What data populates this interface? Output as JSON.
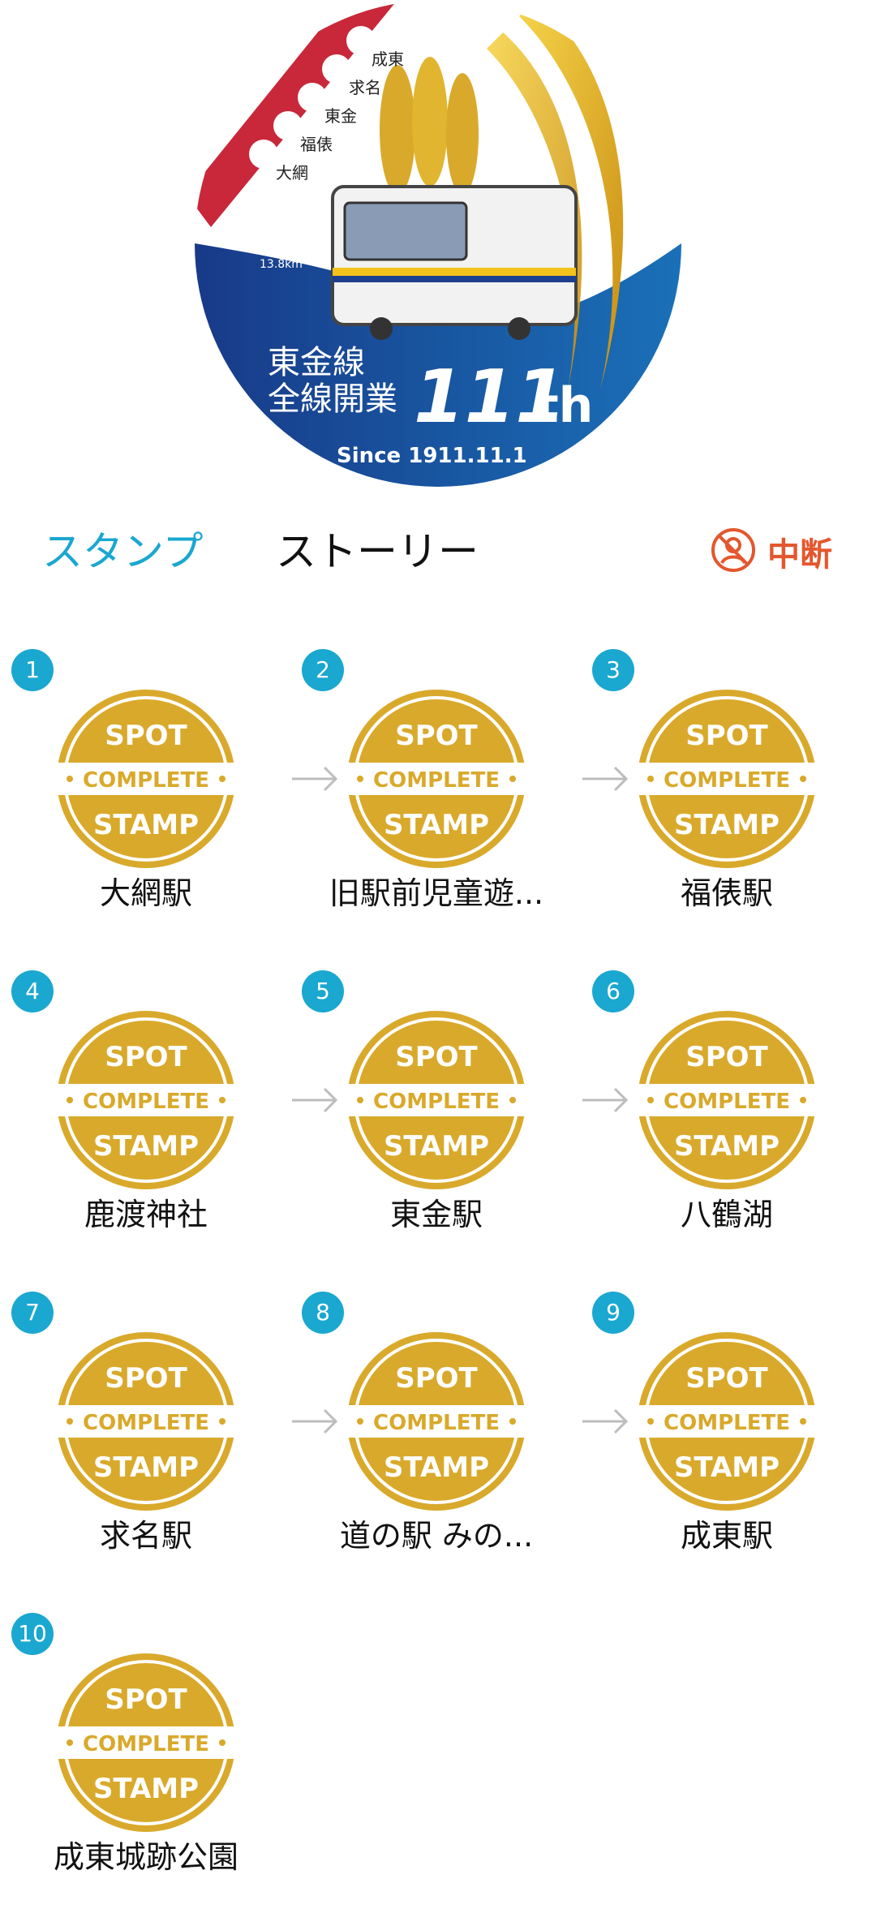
{
  "emblem": {
    "stations": [
      "成東",
      "求名",
      "東金",
      "福俵",
      "大網"
    ],
    "route_label": "Oami - Naruto",
    "distance": "13.8km",
    "title_line1": "東金線",
    "title_line2": "全線開業",
    "anniversary_number": "111",
    "anniversary_suffix": "th",
    "since": "Since 1911.11.1"
  },
  "tabs": {
    "stamp": "スタンプ",
    "story": "ストーリー"
  },
  "pause_label": "中断",
  "stamp_text": {
    "top": "SPOT",
    "middle": "COMPLETE",
    "bottom": "STAMP"
  },
  "spots": [
    {
      "number": "1",
      "name": "大網駅"
    },
    {
      "number": "2",
      "name": "旧駅前児童遊..."
    },
    {
      "number": "3",
      "name": "福俵駅"
    },
    {
      "number": "4",
      "name": "鹿渡神社"
    },
    {
      "number": "5",
      "name": "東金駅"
    },
    {
      "number": "6",
      "name": "八鶴湖"
    },
    {
      "number": "7",
      "name": "求名駅"
    },
    {
      "number": "8",
      "name": "道の駅 みの..."
    },
    {
      "number": "9",
      "name": "成東駅"
    },
    {
      "number": "10",
      "name": "成東城跡公園"
    }
  ],
  "colors": {
    "accent": "#1aa7d0",
    "pause": "#e4572e",
    "stamp_gold": "#d9a92b",
    "emblem_blue": "#1d3f8f",
    "emblem_red": "#c8283a"
  }
}
